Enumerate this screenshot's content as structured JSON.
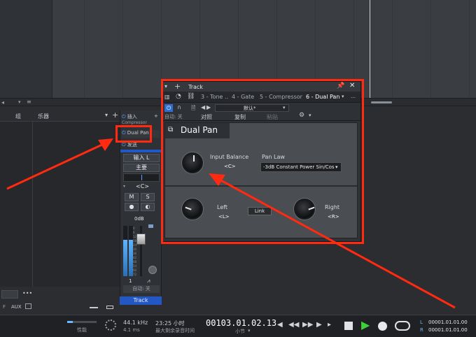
{
  "arrange": {},
  "list": {
    "col_group": "组",
    "col_instrument": "乐器",
    "aux_label": "AUX",
    "more": "•••"
  },
  "strip": {
    "inserts_label": "插入",
    "insert_sub": "Compressor",
    "insert_item": "Dual Pan",
    "sends_label": "发送",
    "input_label": "输入 L",
    "output_label": "主要",
    "pan_value": "<C>",
    "mute": "M",
    "solo": "S",
    "fader_db": "0dB",
    "channel_num": "1",
    "automation": "自动: 关",
    "track_name": "Track",
    "meter_scale": [
      "0",
      "6",
      "12",
      "18",
      "24",
      "30",
      "36",
      "42",
      "48",
      "54",
      "60",
      "72"
    ]
  },
  "plugin": {
    "window_title": "Track",
    "tabs": [
      "3 - Tone ..",
      "4 - Gate",
      "5 - Compressor",
      "6 - Dual Pan"
    ],
    "active_tab_index": 3,
    "preset": "默认*",
    "auto_off": "自动: 关",
    "compare": "对照",
    "copy": "复制",
    "paste": "粘贴",
    "plugin_name": "Dual Pan",
    "input_balance_label": "Input Balance",
    "input_balance_value": "<C>",
    "pan_law_label": "Pan Law",
    "pan_law_value": "-3dB Constant Power Sin/Cos",
    "left_label": "Left",
    "left_value": "<L>",
    "link_label": "Link",
    "right_label": "Right",
    "right_value": "<R>"
  },
  "transport": {
    "performance_label": "性能",
    "sample_rate": "44.1 kHz",
    "latency": "4.1 ms",
    "record_time": "23:25 小时",
    "record_time_label": "最大剩余录音时间",
    "position": "00103.01.02.13",
    "position_label": "小节",
    "loop_l": "00001.01.01.00",
    "loop_r": "00001.01.01.00",
    "l_label": "L",
    "r_label": "R"
  },
  "colors": {
    "highlight_red": "#ff2a10",
    "accent_blue": "#2357c4",
    "play_green": "#3fcf3a"
  }
}
